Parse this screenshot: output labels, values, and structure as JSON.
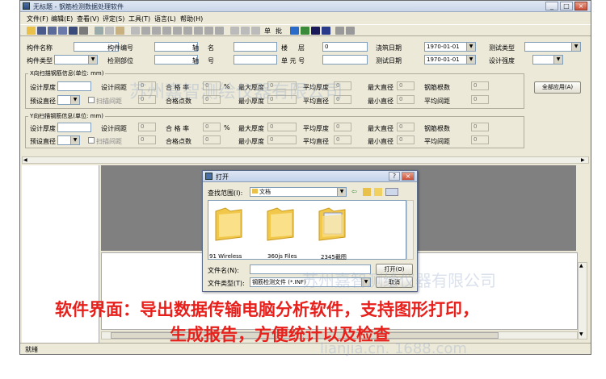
{
  "window": {
    "title": "无标题 - 钢筋检测数据处理软件",
    "controls": [
      "_",
      "□",
      "×"
    ]
  },
  "menu": [
    "文件(F)",
    "编辑(E)",
    "查看(V)",
    "评定(S)",
    "工具(T)",
    "语言(L)",
    "帮助(H)"
  ],
  "toolbar": {
    "text_buttons": [
      "单",
      "批"
    ]
  },
  "form": {
    "row1": {
      "component_name_label": "构件名称",
      "component_no_label": "构件编号",
      "axis_label": "轴",
      "axis_label2": "名",
      "floor_label": "楼",
      "floor_label2": "层",
      "floor_value": "0",
      "pour_date_label": "浇筑日期",
      "pour_date_value": "1970-01-01",
      "test_type_label": "测试类型"
    },
    "row2": {
      "component_type_label": "构件类型",
      "test_part_label": "检测部位",
      "axis_no_label": "轴",
      "axis_no_label2": "号",
      "unit_no_label": "单 元 号",
      "test_date_label": "测试日期",
      "test_date_value": "1970-01-01",
      "design_strength_label": "设计强度"
    },
    "x_group": {
      "title": "X向扫描钢筋信息(单位: mm)",
      "design_thickness_label": "设计厚度",
      "design_spacing_label": "设计间距",
      "design_spacing_value": "0",
      "pass_rate_label": "合 格 率",
      "pass_rate_value": "0",
      "pct": "%",
      "max_thickness_label": "最大厚度",
      "max_thickness_value": "0",
      "avg_thickness_label": "平均厚度",
      "avg_thickness_value": "0",
      "max_diameter_label": "最大直径",
      "max_diameter_value": "0",
      "rebar_count_label": "钢筋根数",
      "rebar_count_value": "0",
      "preset_diameter_label": "预设直径",
      "scan_spacing_label": "扫描间距",
      "pass_points_label": "合格点数",
      "pass_points_value": "0",
      "min_thickness_label": "最小厚度",
      "min_thickness_value": "0",
      "avg_diameter_label": "平均直径",
      "avg_diameter_value": "0",
      "min_diameter_label": "最小直径",
      "min_diameter_value": "0",
      "avg_spacing_label": "平均间距",
      "avg_spacing_value": "0",
      "scan_spacing_value": "0"
    },
    "y_group": {
      "title": "Y向扫描钢筋信息(单位: mm)",
      "design_thickness_label": "设计厚度",
      "design_spacing_label": "设计间距",
      "design_spacing_value": "0",
      "pass_rate_label": "合 格 率",
      "pass_rate_value": "0",
      "pct": "%",
      "max_thickness_label": "最大厚度",
      "max_thickness_value": "0",
      "avg_thickness_label": "平均厚度",
      "avg_thickness_value": "0",
      "max_diameter_label": "最大直径",
      "max_diameter_value": "0",
      "rebar_count_label": "钢筋根数",
      "rebar_count_value": "0",
      "preset_diameter_label": "预设直径",
      "scan_spacing_label": "扫描间距",
      "pass_points_label": "合格点数",
      "pass_points_value": "0",
      "min_thickness_label": "最小厚度",
      "min_thickness_value": "0",
      "avg_diameter_label": "平均直径",
      "avg_diameter_value": "0",
      "min_diameter_label": "最小直径",
      "min_diameter_value": "0",
      "avg_spacing_label": "平均间距",
      "avg_spacing_value": "0",
      "scan_spacing_value": "0"
    },
    "apply_all_button": "全部应用(A)"
  },
  "dialog": {
    "title": "打开",
    "lookin_label": "查找范围(I):",
    "lookin_value": "文档",
    "files": [
      {
        "name": "91 Wireless"
      },
      {
        "name": "360js Files"
      },
      {
        "name": "2345截图"
      }
    ],
    "filename_label": "文件名(N):",
    "filetype_label": "文件类型(T):",
    "filetype_value": "钢筋检测文件 (*.INF)",
    "open_button": "打开(O)",
    "cancel_button": "取消"
  },
  "status": {
    "text": "就绪"
  },
  "caption": {
    "line1": "软件界面：导出数据传输电脑分析软件，支持图形打印，",
    "line2": "生成报告，方便统计以及检查"
  },
  "watermarks": [
    "苏州嘉智测绘仪器有限公司",
    "苏州嘉智测绘仪器有限公司",
    "lianjia.cn. 1688.com"
  ],
  "colors": {
    "caption": "#e8201c",
    "window_bg": "#ece9d8",
    "gray_panel": "#808080"
  }
}
